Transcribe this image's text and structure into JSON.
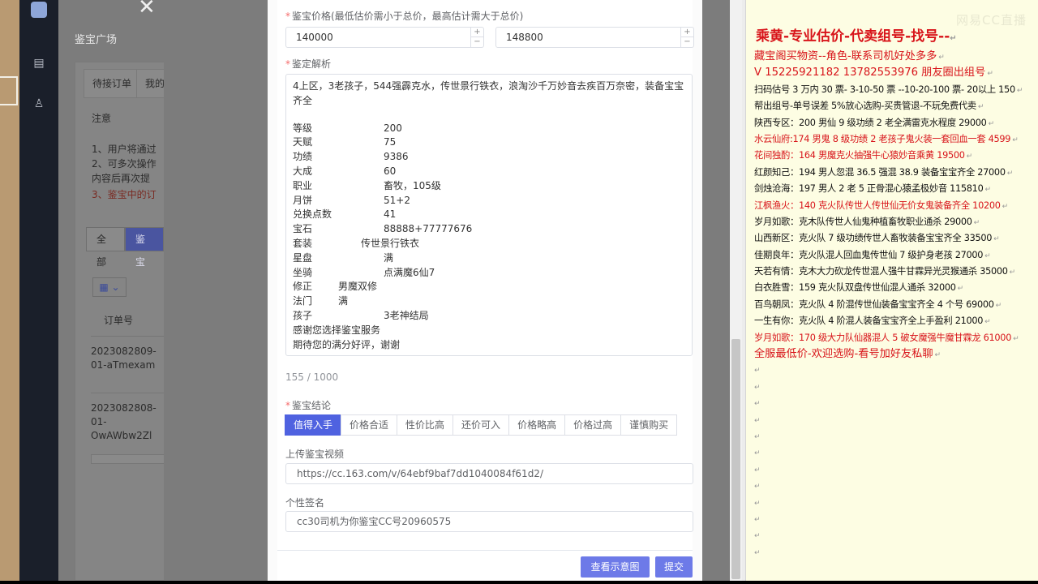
{
  "background_app": {
    "title": "鉴宝广场",
    "tabs": [
      "待接订单",
      "我的"
    ],
    "notice_title": "注意",
    "notice_lines": [
      "1、用户将通过",
      "2、可多次操作",
      "内容后再次提",
      "3、鉴宝中的订"
    ],
    "filters": [
      "全部",
      "鉴宝"
    ],
    "column_header": "订单号",
    "rows": [
      [
        "2023082809-",
        "01-aTmexam"
      ],
      [
        "2023082808-",
        "01-",
        "OwAWbw2Zl"
      ]
    ],
    "grid_icon": "grid-icon",
    "close_icon": "close-icon"
  },
  "form": {
    "price_label": "鉴宝价格(最低估价需小于总价，最高估计需大于总价)",
    "price_min": "140000",
    "price_max": "148800",
    "analysis_label": "鉴定解析",
    "analysis_intro": "4上区，3老孩子，544强霹克水，传世景行铁衣，浪淘沙千万妙音去疾百万奈密，装备宝宝齐全",
    "analysis_fields": [
      {
        "k": "等级",
        "v": "200",
        "w": 112
      },
      {
        "k": "天赋",
        "v": "75",
        "w": 112
      },
      {
        "k": "功绩",
        "v": "9386",
        "w": 112
      },
      {
        "k": "大成",
        "v": "60",
        "w": 112
      },
      {
        "k": "职业",
        "v": "畜牧，105级",
        "w": 112
      },
      {
        "k": "月饼",
        "v": "51+2",
        "w": 112
      },
      {
        "k": "兑换点数",
        "v": "41",
        "w": 112
      },
      {
        "k": "宝石",
        "v": "88888+77777676",
        "w": 112
      },
      {
        "k": "套装",
        "v": "传世景行铁衣",
        "w": 84
      },
      {
        "k": "星盘",
        "v": "满",
        "w": 112
      },
      {
        "k": "坐骑",
        "v": "点满魔6仙7",
        "w": 112
      },
      {
        "k": "修正",
        "v": "男魔双修",
        "w": 56
      },
      {
        "k": "法门",
        "v": "满",
        "w": 56
      },
      {
        "k": "孩子",
        "v": "3老神结局",
        "w": 112
      }
    ],
    "analysis_outro": [
      "感谢您选择鉴宝服务",
      "期待您的满分好评，谢谢"
    ],
    "counter": "155 / 1000",
    "conclusion_label": "鉴宝结论",
    "conclusions": [
      "值得入手",
      "价格合适",
      "性价比高",
      "还价可入",
      "价格略高",
      "价格过高",
      "谨慎购买"
    ],
    "selected_conclusion": "值得入手",
    "video_label": "上传鉴宝视频",
    "video_url": "https://cc.163.com/v/64ebf9baf7dd1040084f61d2/",
    "signature_label": "个性签名",
    "signature": "cc30司机为你鉴宝CC号20960575",
    "preview_button": "查看示意图",
    "submit_button": "提交"
  },
  "notes": {
    "watermark": "网易CC直播",
    "title": "乘黄-专业估价-代卖组号-找号--",
    "lines": [
      {
        "text": "藏宝阁买物资--角色-联系司机好处多多",
        "red": true,
        "big": true
      },
      {
        "text": "V 15225921182   13782553976 朋友圈出组号",
        "red": true,
        "big": true
      },
      {
        "text": "扫码估号 3 万内 30 票- 3-10-50 票  --10-20-100 票- 20以上 150",
        "red": false
      },
      {
        "text": "帮出组号-单号误差 5%放心选购-买贵管退-不玩免费代卖",
        "red": false
      },
      {
        "text": "陕西专区：200 男仙 9 级功绩 2 老全满雷克水程度 29000",
        "red": false
      },
      {
        "text": "水云仙府:174 男鬼 8 级功绩 2 老孩子鬼火装一套回血一套 4599",
        "red": true
      },
      {
        "text": "花间独酌：164 男魔克火抽强牛心猿妙音乘黄 19500",
        "red": true
      },
      {
        "text": "红颜知己：194 男人忽混 36.5 强混 38.9 装备宝宝齐全 27000",
        "red": false
      },
      {
        "text": "剑烛沧海：197 男人 2 老 5 正骨混心猿孟极妙音 115810",
        "red": false
      },
      {
        "text": "江枫渔火：140 克火队传世人传世仙无价女鬼装备齐全 10200",
        "red": true
      },
      {
        "text": "岁月如歌：克木队传世人仙鬼种植畜牧职业通杀 29000",
        "red": false
      },
      {
        "text": "山西新区：克火队 7 级功绩传世人畜牧装备宝宝齐全 33500",
        "red": false
      },
      {
        "text": "佳期良年：克火队混人回血鬼传世仙 7 级护身老孩 27000",
        "red": false
      },
      {
        "text": "天若有情：克木大力砍龙传世混人强牛甘霖异光灵猴通杀 35000",
        "red": false
      },
      {
        "text": "白衣胜雪：159 克火队双盘传世仙混人通杀 32000",
        "red": false
      },
      {
        "text": "百鸟朝凤：克火队 4 阶混传世仙装备宝宝齐全 4 个号 69000",
        "red": false
      },
      {
        "text": "一生有你：克火队 4 阶混人装备宝宝齐全上手盈利 21000",
        "red": false
      },
      {
        "text": "岁月如歌：170 级大力队仙器混人 5 破女魔强牛魔甘霖龙 61000",
        "red": true
      },
      {
        "text": "全服最低价-欢迎选购-看号加好友私聊",
        "red": true,
        "big": true
      }
    ],
    "empty_line_count": 12,
    "line_mark": "↵"
  },
  "colors": {
    "accent": "#4f62e0",
    "button": "#6d7ae8",
    "notes_red": "#d8141a",
    "notes_bg": "#fdfde3",
    "required_star": "#f56c6c"
  }
}
